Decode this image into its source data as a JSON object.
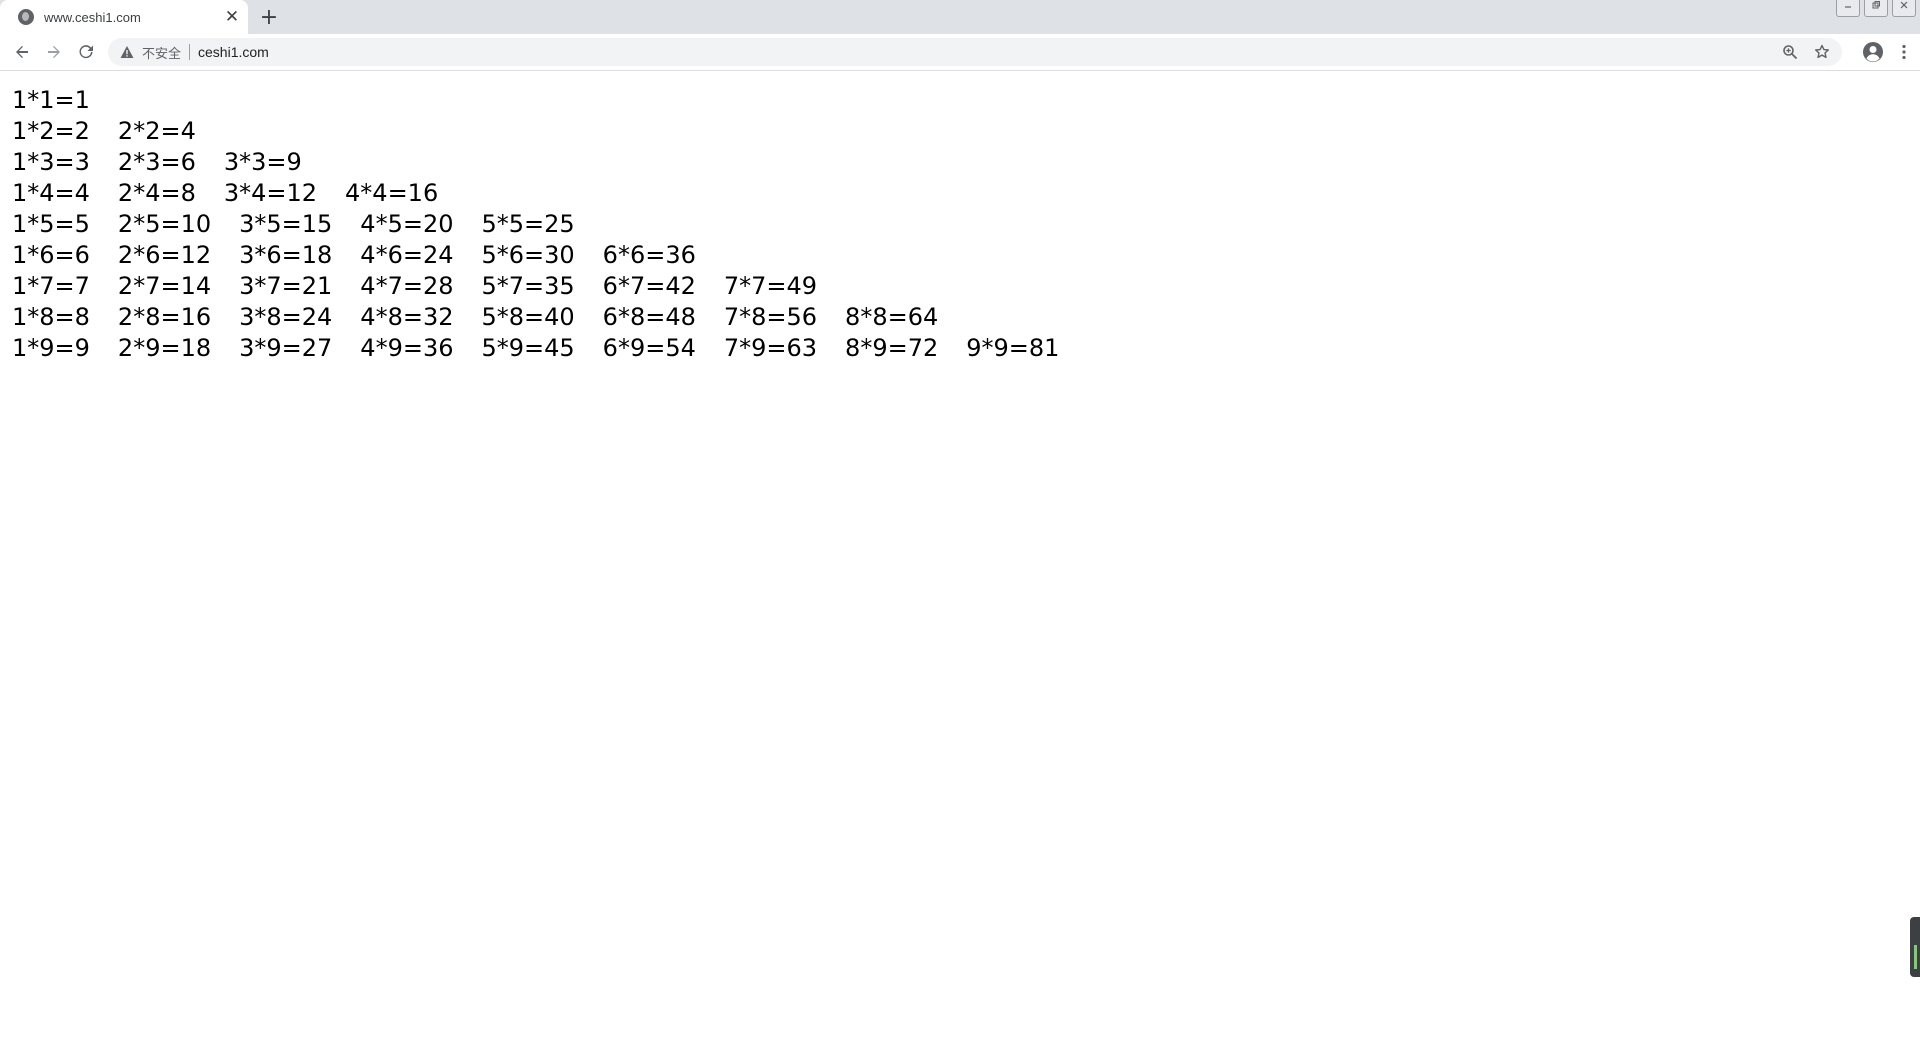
{
  "tab": {
    "title": "www.ceshi1.com",
    "close_glyph": "✕",
    "new_tab_glyph": "+"
  },
  "window_controls": [
    "minimize",
    "restore",
    "close"
  ],
  "toolbar": {
    "security_label": "不安全",
    "url": "ceshi1.com"
  },
  "table": {
    "rows": [
      [
        "1*1=1"
      ],
      [
        "1*2=2",
        "2*2=4"
      ],
      [
        "1*3=3",
        "2*3=6",
        "3*3=9"
      ],
      [
        "1*4=4",
        "2*4=8",
        "3*4=12",
        "4*4=16"
      ],
      [
        "1*5=5",
        "2*5=10",
        "3*5=15",
        "4*5=20",
        "5*5=25"
      ],
      [
        "1*6=6",
        "2*6=12",
        "3*6=18",
        "4*6=24",
        "5*6=30",
        "6*6=36"
      ],
      [
        "1*7=7",
        "2*7=14",
        "3*7=21",
        "4*7=28",
        "5*7=35",
        "6*7=42",
        "7*7=49"
      ],
      [
        "1*8=8",
        "2*8=16",
        "3*8=24",
        "4*8=32",
        "5*8=40",
        "6*8=48",
        "7*8=56",
        "8*8=64"
      ],
      [
        "1*9=9",
        "2*9=18",
        "3*9=27",
        "4*9=36",
        "5*9=45",
        "6*9=54",
        "7*9=63",
        "8*9=72",
        "9*9=81"
      ]
    ]
  },
  "icons": {
    "back": "back-arrow-icon",
    "forward": "forward-arrow-icon",
    "reload": "reload-icon",
    "warning": "warning-triangle-icon",
    "zoom": "zoom-icon",
    "bookmark": "star-icon",
    "profile": "profile-icon",
    "menu": "menu-dots-icon"
  },
  "colors": {
    "tabstrip_bg": "#dee1e6",
    "omnibox_bg": "#f1f3f4",
    "text": "#000000"
  }
}
